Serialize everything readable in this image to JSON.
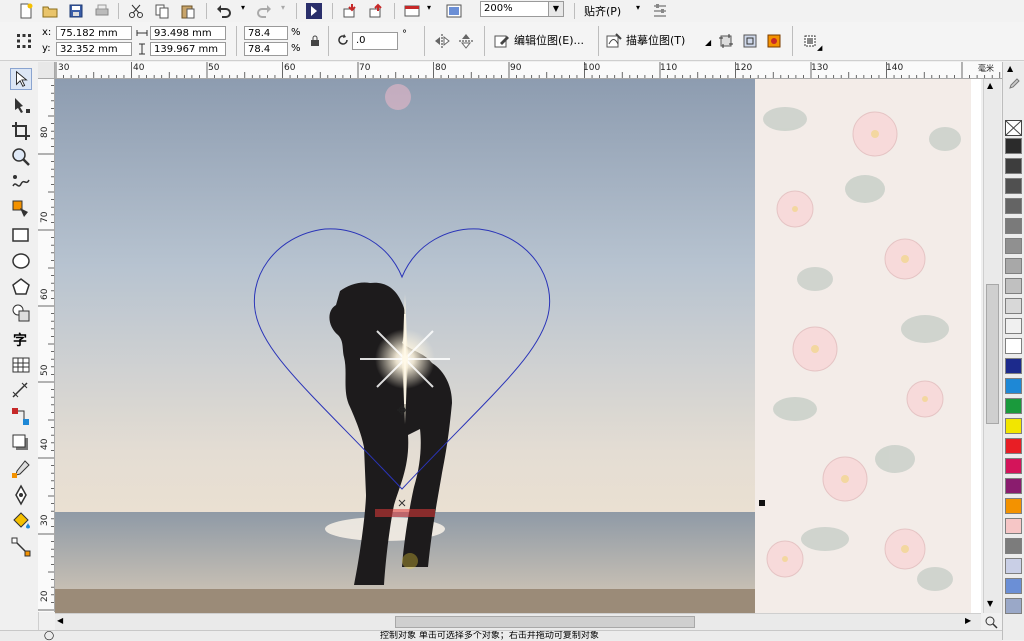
{
  "toolbar": {
    "zoom_value": "200%",
    "snap_label": "贴齐(P)"
  },
  "properties": {
    "x_label": "x:",
    "x_value": "75.182 mm",
    "y_label": "y:",
    "y_value": "32.352 mm",
    "width_value": "93.498 mm",
    "height_value": "139.967 mm",
    "scale_x": "78.4",
    "scale_y": "78.4",
    "percent_symbol": "%",
    "rotation_value": ".0",
    "degree_symbol": "°",
    "edit_bitmap_label": "编辑位图(E)...",
    "trace_bitmap_label": "描摹位图(T)"
  },
  "tools": [
    "pick-tool",
    "shape-tool",
    "crop-tool",
    "zoom-tool",
    "freehand-tool",
    "smart-fill-tool",
    "rectangle-tool",
    "ellipse-tool",
    "polygon-tool",
    "basic-shapes-tool",
    "text-tool",
    "table-tool",
    "dimension-tool",
    "connector-tool",
    "drop-shadow-tool",
    "eyedropper-tool",
    "outline-tool",
    "fill-tool",
    "interactive-fill-tool"
  ],
  "text_tool_glyph": "字",
  "ruler": {
    "top_labels": [
      "30",
      "40",
      "50",
      "60",
      "70",
      "80",
      "90",
      "100",
      "110",
      "120",
      "130",
      "140"
    ],
    "unit": "毫米",
    "left_labels": [
      "80",
      "70",
      "60",
      "50",
      "40",
      "30",
      "20"
    ]
  },
  "palette_colors": [
    "#2b2b2b",
    "#3d3d3d",
    "#505050",
    "#646464",
    "#7a7a7a",
    "#909090",
    "#a8a8a8",
    "#c0c0c0",
    "#d8d8d8",
    "#f0f0f0",
    "#ffffff",
    "#1c2a8c",
    "#1e88d6",
    "#1a9a3c",
    "#f2e600",
    "#e81e25",
    "#d4145a",
    "#8a1c6e",
    "#f39200",
    "#f6c6c6",
    "#7c7c7c",
    "#c9cfe6",
    "#6b8fd6",
    "#9aa8c8"
  ],
  "status": {
    "text": "控制对象  单击可选择多个对象；右击并拖动可复制对象"
  }
}
